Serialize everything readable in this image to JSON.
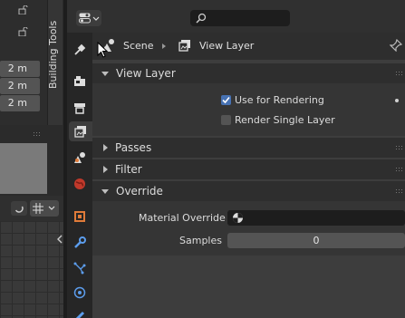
{
  "sidebar_tab": {
    "label": "Building Tools"
  },
  "dimensions": [
    "2 m",
    "2 m",
    "2 m"
  ],
  "breadcrumb": {
    "scene": "Scene",
    "view_layer": "View Layer"
  },
  "panels": {
    "view_layer": {
      "title": "View Layer",
      "use_for_rendering": {
        "label": "Use for Rendering",
        "checked": true
      },
      "render_single_layer": {
        "label": "Render Single Layer",
        "checked": false
      }
    },
    "passes": {
      "title": "Passes"
    },
    "filter": {
      "title": "Filter"
    },
    "override": {
      "title": "Override",
      "material_override": {
        "label": "Material Override"
      },
      "samples": {
        "label": "Samples",
        "value": "0"
      }
    }
  },
  "colors": {
    "accent": "#4772b3",
    "panel": "#3d3d3d",
    "header": "#2e2e2e"
  }
}
